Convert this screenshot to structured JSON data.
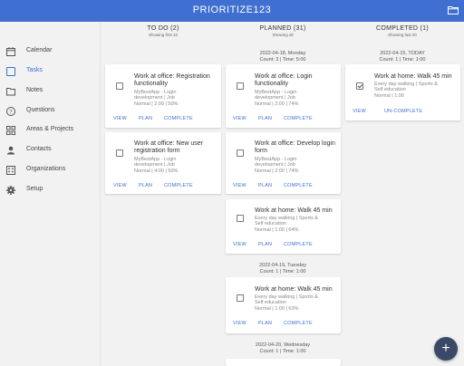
{
  "app": {
    "title": "PRIORITIZE123"
  },
  "icons": {
    "folder": "folder-icon",
    "add": "plus-icon"
  },
  "sidebar": {
    "items": [
      {
        "label": "Calendar",
        "icon": "calendar-icon"
      },
      {
        "label": "Tasks",
        "icon": "checkbox-icon",
        "active": true
      },
      {
        "label": "Notes",
        "icon": "folder-icon"
      },
      {
        "label": "Questions",
        "icon": "question-icon"
      },
      {
        "label": "Areas & Projects",
        "icon": "grid-icon"
      },
      {
        "label": "Contacts",
        "icon": "person-icon"
      },
      {
        "label": "Organizations",
        "icon": "building-icon"
      },
      {
        "label": "Setup",
        "icon": "gear-icon"
      }
    ]
  },
  "columns": {
    "todo": {
      "title": "TO DO (2)",
      "subtitle": "Showing first 10"
    },
    "planned": {
      "title": "PLANNED (31)",
      "subtitle": "Showing all"
    },
    "completed": {
      "title": "COMPLETED (1)",
      "subtitle": "Showing last 20"
    }
  },
  "todo_cards": [
    {
      "title": "Work at office: Registration functionality",
      "meta1": "MyBestApp - Login",
      "meta2": "development | Job",
      "meta3": "Normal | 2:00 | 50%",
      "actions": [
        "VIEW",
        "PLAN",
        "COMPLETE"
      ]
    },
    {
      "title": "Work at office: New user registration form",
      "meta1": "MyBestApp - Login",
      "meta2": "development | Job",
      "meta3": "Normal | 4:00 | 50%",
      "actions": [
        "VIEW",
        "PLAN",
        "COMPLETE"
      ]
    }
  ],
  "planned_groups": [
    {
      "date": "2022-04-18, Monday",
      "summary": "Count: 3 | Time: 5:00"
    },
    {
      "date": "2022-04-19, Tuesday",
      "summary": "Count: 1 | Time: 1:00"
    },
    {
      "date": "2022-04-20, Wednesday",
      "summary": "Count: 1 | Time: 1:00"
    }
  ],
  "planned_cards": [
    {
      "title": "Work at office: Login functionality",
      "meta1": "MyBestApp - Login",
      "meta2": "development | Job",
      "meta3": "Normal | 2:00 | 74%",
      "actions": [
        "VIEW",
        "PLAN",
        "COMPLETE"
      ]
    },
    {
      "title": "Work at office: Develop login form",
      "meta1": "MyBestApp - Login",
      "meta2": "development | Job",
      "meta3": "Normal | 2:00 | 74%",
      "actions": [
        "VIEW",
        "PLAN",
        "COMPLETE"
      ]
    },
    {
      "title": "Work at home: Walk 45 min",
      "meta1": "Every day walking | Sports &",
      "meta2": "Self education",
      "meta3": "Normal | 1:00 | 64%",
      "actions": [
        "VIEW",
        "PLAN",
        "COMPLETE"
      ]
    },
    {
      "title": "Work at home: Walk 45 min",
      "meta1": "Every day walking | Sports &",
      "meta2": "Self education",
      "meta3": "Normal | 1:00 | 63%",
      "actions": [
        "VIEW",
        "PLAN",
        "COMPLETE"
      ]
    }
  ],
  "completed_groups": [
    {
      "date": "2022-04-15, TODAY",
      "summary": "Count: 1 | Time: 1:00"
    }
  ],
  "completed_cards": [
    {
      "title": "Work at home: Walk 45 min",
      "meta1": "Every day walking | Sports &",
      "meta2": "Self education",
      "meta3": "Normal | 1:00",
      "actions": [
        "VIEW",
        "UN-COMPLETE"
      ]
    }
  ]
}
